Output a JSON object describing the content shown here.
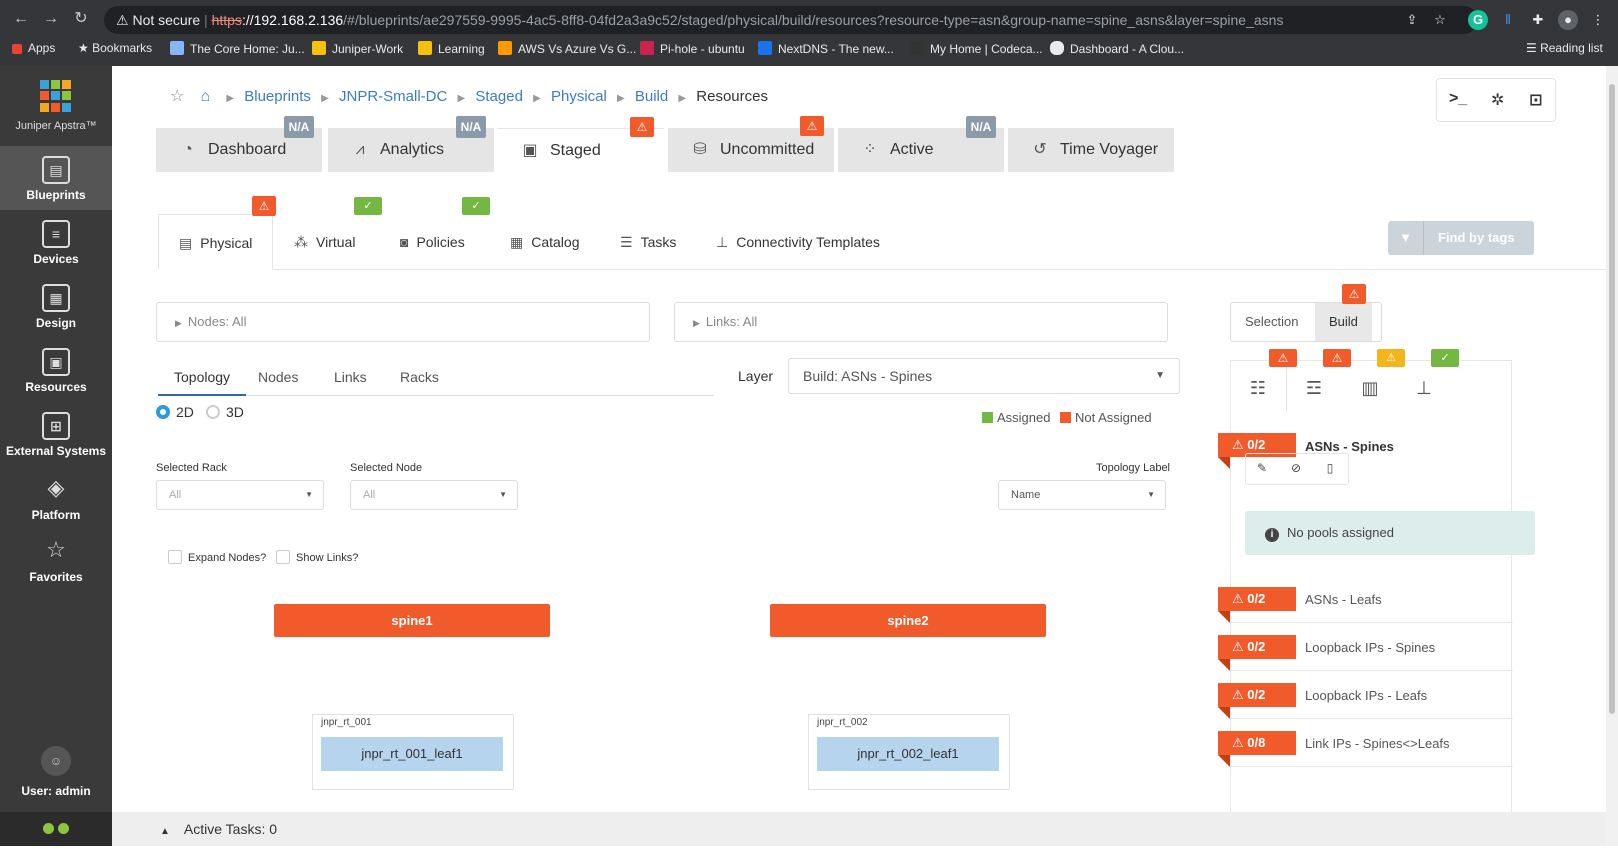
{
  "browser": {
    "security_label": "Not secure",
    "url_scheme": "https",
    "url_host": "://192.168.2.136",
    "url_rest": "/#/blueprints/ae297559-9995-4ac5-8ff8-04fd2a3a9c52/staged/physical/build/resources?resource-type=asn&group-name=spine_asns&layer=spine_asns",
    "bookmarks": [
      "Apps",
      "Bookmarks",
      "The Core Home: Ju...",
      "Juniper-Work",
      "Learning",
      "AWS Vs Azure Vs G...",
      "Pi-hole - ubuntu",
      "NextDNS - The new...",
      "My Home | Codeca...",
      "Dashboard - A Clou..."
    ],
    "reading_list": "Reading list"
  },
  "sidebar": {
    "logo_text": "Juniper Apstra™",
    "items": [
      {
        "label": "Blueprints"
      },
      {
        "label": "Devices"
      },
      {
        "label": "Design"
      },
      {
        "label": "Resources"
      },
      {
        "label": "External Systems"
      },
      {
        "label": "Platform"
      },
      {
        "label": "Favorites"
      }
    ],
    "user": "User: admin"
  },
  "breadcrumb": {
    "items": [
      "Blueprints",
      "JNPR-Small-DC",
      "Staged",
      "Physical",
      "Build"
    ],
    "current": "Resources"
  },
  "main_tabs": [
    {
      "label": "Dashboard",
      "badge": "N/A"
    },
    {
      "label": "Analytics",
      "badge": "N/A"
    },
    {
      "label": "Staged",
      "badge": "!"
    },
    {
      "label": "Uncommitted",
      "badge": "!"
    },
    {
      "label": "Active",
      "badge": "N/A"
    },
    {
      "label": "Time Voyager",
      "badge": ""
    }
  ],
  "sub_tabs": [
    "Physical",
    "Virtual",
    "Policies",
    "Catalog",
    "Tasks",
    "Connectivity Templates"
  ],
  "find_by_tags": "Find by tags",
  "filters": {
    "nodes": "Nodes: All",
    "links": "Links: All"
  },
  "panel_toggle": {
    "selection": "Selection",
    "build": "Build"
  },
  "topo_tabs": [
    "Topology",
    "Nodes",
    "Links",
    "Racks"
  ],
  "view_mode": {
    "two_d": "2D",
    "three_d": "3D"
  },
  "layer": {
    "label": "Layer",
    "value": "Build: ASNs - Spines"
  },
  "legend": {
    "assigned": "Assigned",
    "not_assigned": "Not Assigned",
    "assigned_color": "#74b843",
    "not_assigned_color": "#f15a2b"
  },
  "selected_rack": {
    "label": "Selected Rack",
    "value": "All"
  },
  "selected_node": {
    "label": "Selected Node",
    "value": "All"
  },
  "topology_label": {
    "label": "Topology Label",
    "value": "Name"
  },
  "checkboxes": {
    "expand_nodes": "Expand Nodes?",
    "show_links": "Show Links?"
  },
  "spines": [
    "spine1",
    "spine2"
  ],
  "racks": [
    {
      "label": "jnpr_rt_001",
      "leaf": "jnpr_rt_001_leaf1"
    },
    {
      "label": "jnpr_rt_002",
      "leaf": "jnpr_rt_002_leaf1"
    }
  ],
  "resources": {
    "main": {
      "count": "0/2",
      "name": "ASNs - Spines"
    },
    "info": "No pools assigned",
    "rows": [
      {
        "count": "0/2",
        "name": "ASNs - Leafs"
      },
      {
        "count": "0/2",
        "name": "Loopback IPs - Spines"
      },
      {
        "count": "0/2",
        "name": "Loopback IPs - Leafs"
      },
      {
        "count": "0/8",
        "name": "Link IPs - Spines<>Leafs"
      }
    ]
  },
  "active_tasks": "Active Tasks: 0"
}
